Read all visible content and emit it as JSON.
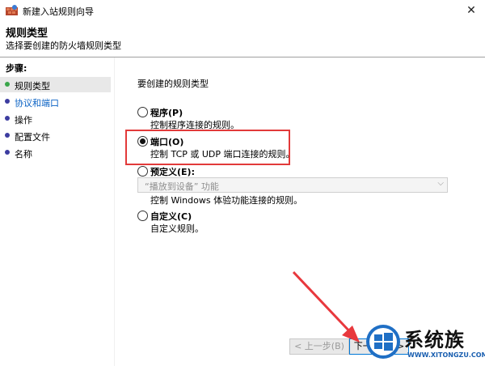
{
  "window": {
    "title": "新建入站规则向导",
    "close_glyph": "✕"
  },
  "header": {
    "title": "规则类型",
    "subtitle": "选择要创建的防火墙规则类型"
  },
  "sidebar": {
    "label": "步骤:",
    "steps": [
      {
        "label": "规则类型"
      },
      {
        "label": "协议和端口"
      },
      {
        "label": "操作"
      },
      {
        "label": "配置文件"
      },
      {
        "label": "名称"
      }
    ]
  },
  "main": {
    "prompt": "要创建的规则类型",
    "options": [
      {
        "label": "程序(P)",
        "desc": "控制程序连接的规则。",
        "selected": false
      },
      {
        "label": "端口(O)",
        "desc": "控制 TCP 或 UDP 端口连接的规则。",
        "selected": true
      },
      {
        "label": "预定义(E):",
        "desc": "控制 Windows 体验功能连接的规则。",
        "selected": false,
        "combo_value": "“播放到设备” 功能"
      },
      {
        "label": "自定义(C)",
        "desc": "自定义规则。",
        "selected": false
      }
    ]
  },
  "buttons": {
    "back": "< 上一步(B)",
    "next": "下一步(N) >"
  },
  "watermark": {
    "text": "系统族",
    "url": "WWW.XITONGZU.COM"
  },
  "colors": {
    "highlight": "#e23a3a",
    "arrow": "#e8383d",
    "step_done": "#3aa64a",
    "step_pending": "#3c3ca0",
    "link": "#0a62c4"
  }
}
